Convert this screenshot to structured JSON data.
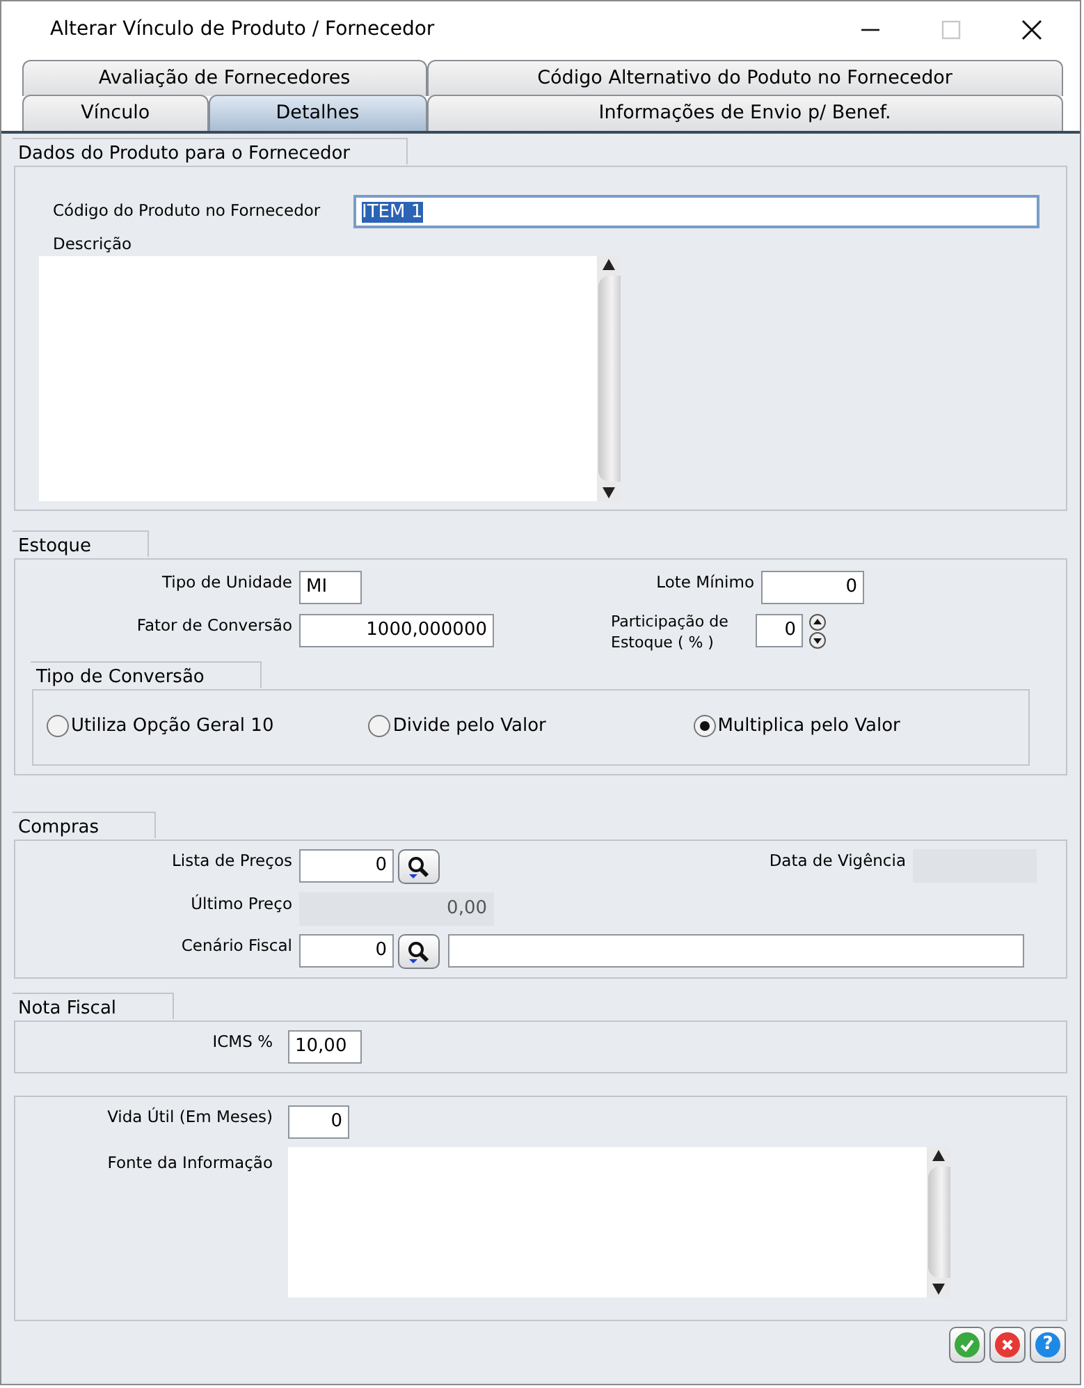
{
  "window": {
    "title": "Alterar Vínculo de Produto / Fornecedor",
    "controls": [
      {
        "kind": "minimize",
        "disabled": false
      },
      {
        "kind": "maximize",
        "disabled": true
      },
      {
        "kind": "close",
        "disabled": false
      }
    ]
  },
  "tab_rows": [
    {
      "tabs": [
        {
          "label": "Avaliação de Fornecedores",
          "selected": false
        },
        {
          "label": "Código Alternativo do Poduto no Fornecedor",
          "selected": false
        }
      ]
    },
    {
      "tabs": [
        {
          "label": "Vínculo",
          "selected": false
        },
        {
          "label": "Detalhes",
          "selected": true
        },
        {
          "label": "Informações de Envio p/ Benef.",
          "selected": false
        }
      ]
    }
  ],
  "product": {
    "title": "Dados do Produto para o Fornecedor",
    "code": {
      "label": "Código do Produto no Fornecedor",
      "value": "ITEM 1",
      "highlighted": true
    },
    "description": {
      "label": "Descrição"
    }
  },
  "stock": {
    "title": "Estoque",
    "unit_type": {
      "label": "Tipo de Unidade",
      "value": "MI"
    },
    "conversion_factor": {
      "label": "Fator de Conversão",
      "value": "1000,000000"
    },
    "min_lot": {
      "label": "Lote Mínimo",
      "value": "0"
    },
    "stock_share": {
      "label": "Participação de Estoque ( % )",
      "value": "0"
    },
    "conversion_type": {
      "title": "Tipo de Conversão",
      "options": [
        {
          "label": "Utiliza Opção Geral 10",
          "selected": false
        },
        {
          "label": "Divide pelo Valor",
          "selected": false
        },
        {
          "label": "Multiplica pelo Valor",
          "selected": true
        }
      ]
    }
  },
  "purchases": {
    "title": "Compras",
    "price_list": {
      "label": "Lista de Preços",
      "value": "0"
    },
    "validity_date": {
      "label": "Data de Vigência",
      "disabled": true
    },
    "last_price": {
      "label": "Último Preço",
      "value": "0,00",
      "disabled": true
    },
    "tax_scenario": {
      "label": "Cenário Fiscal",
      "value": "0"
    }
  },
  "invoice": {
    "title": "Nota Fiscal",
    "icms": {
      "label": "ICMS %",
      "value": "10,00"
    }
  },
  "extra": {
    "useful_life": {
      "label": "Vida Útil (Em Meses)",
      "value": "0"
    },
    "info_source": {
      "label": "Fonte da Informação"
    }
  },
  "buttons": [
    {
      "kind": "ok"
    },
    {
      "kind": "cancel"
    },
    {
      "kind": "help",
      "label": "?"
    }
  ]
}
